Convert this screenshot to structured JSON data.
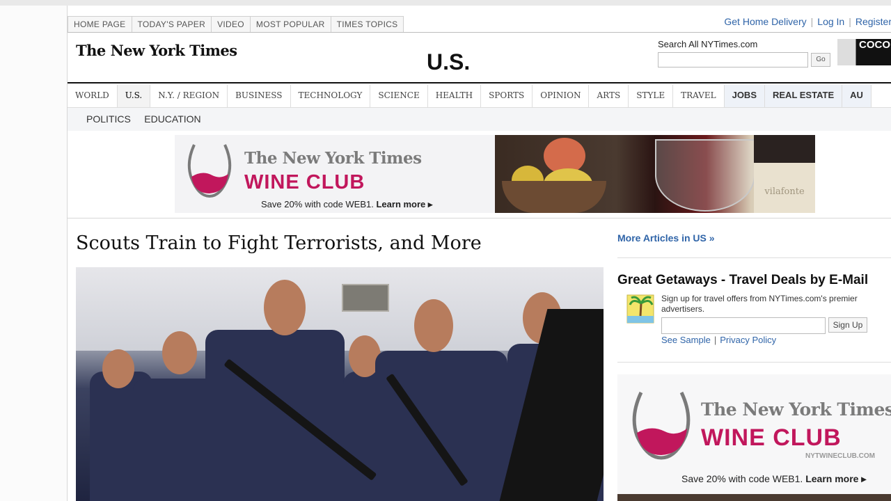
{
  "utility_nav": {
    "tabs": [
      "HOME PAGE",
      "TODAY'S PAPER",
      "VIDEO",
      "MOST POPULAR",
      "TIMES TOPICS"
    ],
    "links": [
      "Get Home Delivery",
      "Log In",
      "Register"
    ],
    "separator": "|"
  },
  "masthead": {
    "logo": "The New York Times",
    "section_title": "U.S."
  },
  "search": {
    "label": "Search All NYTimes.com",
    "placeholder": "",
    "go_label": "Go"
  },
  "ad_thumb": {
    "text": "COCO"
  },
  "section_nav": {
    "items": [
      "WORLD",
      "U.S.",
      "N.Y. / REGION",
      "BUSINESS",
      "TECHNOLOGY",
      "SCIENCE",
      "HEALTH",
      "SPORTS",
      "OPINION",
      "ARTS",
      "STYLE",
      "TRAVEL",
      "JOBS",
      "REAL ESTATE",
      "AU"
    ],
    "active_index": 1,
    "subnav": [
      "POLITICS",
      "EDUCATION"
    ]
  },
  "banner_ad": {
    "brand": "The New York Times",
    "product": "WINE CLUB",
    "promo": "Save 20% with code WEB1.",
    "cta": "Learn more ▸",
    "bottle_label": "vilafonte"
  },
  "article": {
    "headline": "Scouts Train to Fight Terrorists, and More"
  },
  "sidebar": {
    "more_articles": "More Articles in US »",
    "getaways": {
      "title": "Great Getaways - Travel Deals by E-Mail",
      "description": "Sign up for travel offers from NYTimes.com's premier advertisers.",
      "signup_label": "Sign Up",
      "links": [
        "See Sample",
        "Privacy Policy"
      ],
      "separator": "|"
    },
    "wine_ad": {
      "brand": "The New York Times",
      "product": "WINE CLUB",
      "url": "NYTWINECLUB.COM",
      "promo": "Save 20% with code WEB1.",
      "cta": "Learn more ▸"
    }
  },
  "colors": {
    "link_blue": "#2f64a8",
    "wine_pink": "#c1175c"
  }
}
